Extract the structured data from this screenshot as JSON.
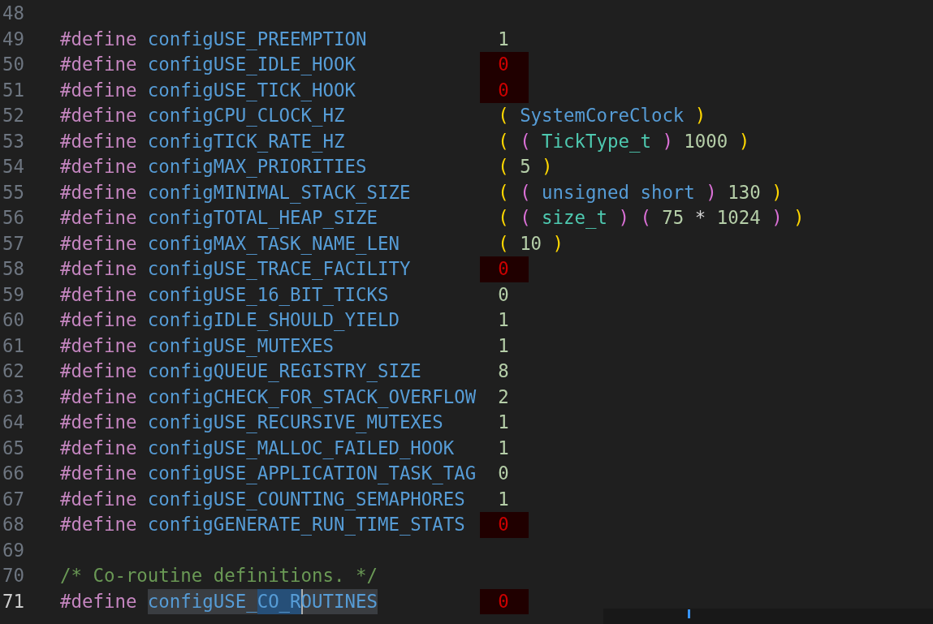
{
  "editor": {
    "lines": [
      {
        "number": "48",
        "kind": "blank",
        "current": false
      },
      {
        "number": "49",
        "kind": "define",
        "current": false,
        "directive": "#define",
        "name": "configUSE_PREEMPTION",
        "flagged": false,
        "value": [
          {
            "kind": "number",
            "text": "1"
          }
        ]
      },
      {
        "number": "50",
        "kind": "define",
        "current": false,
        "directive": "#define",
        "name": "configUSE_IDLE_HOOK",
        "flagged": true,
        "value": [
          {
            "kind": "number",
            "text": "0"
          }
        ]
      },
      {
        "number": "51",
        "kind": "define",
        "current": false,
        "directive": "#define",
        "name": "configUSE_TICK_HOOK",
        "flagged": true,
        "value": [
          {
            "kind": "number",
            "text": "0"
          }
        ]
      },
      {
        "number": "52",
        "kind": "define",
        "current": false,
        "directive": "#define",
        "name": "configCPU_CLOCK_HZ",
        "flagged": false,
        "value": [
          {
            "kind": "paren1",
            "text": "("
          },
          {
            "kind": "identifier",
            "text": "SystemCoreClock"
          },
          {
            "kind": "paren1",
            "text": ")"
          }
        ]
      },
      {
        "number": "53",
        "kind": "define",
        "current": false,
        "directive": "#define",
        "name": "configTICK_RATE_HZ",
        "flagged": false,
        "value": [
          {
            "kind": "paren1",
            "text": "("
          },
          {
            "kind": "paren2",
            "text": "("
          },
          {
            "kind": "type",
            "text": "TickType_t"
          },
          {
            "kind": "paren2",
            "text": ")"
          },
          {
            "kind": "number",
            "text": "1000"
          },
          {
            "kind": "paren1",
            "text": ")"
          }
        ]
      },
      {
        "number": "54",
        "kind": "define",
        "current": false,
        "directive": "#define",
        "name": "configMAX_PRIORITIES",
        "flagged": false,
        "value": [
          {
            "kind": "paren1",
            "text": "("
          },
          {
            "kind": "number",
            "text": "5"
          },
          {
            "kind": "paren1",
            "text": ")"
          }
        ]
      },
      {
        "number": "55",
        "kind": "define",
        "current": false,
        "directive": "#define",
        "name": "configMINIMAL_STACK_SIZE",
        "flagged": false,
        "value": [
          {
            "kind": "paren1",
            "text": "("
          },
          {
            "kind": "paren2",
            "text": "("
          },
          {
            "kind": "keyword",
            "text": "unsigned short"
          },
          {
            "kind": "paren2",
            "text": ")"
          },
          {
            "kind": "number",
            "text": "130"
          },
          {
            "kind": "paren1",
            "text": ")"
          }
        ]
      },
      {
        "number": "56",
        "kind": "define",
        "current": false,
        "directive": "#define",
        "name": "configTOTAL_HEAP_SIZE",
        "flagged": false,
        "value": [
          {
            "kind": "paren1",
            "text": "("
          },
          {
            "kind": "paren2",
            "text": "("
          },
          {
            "kind": "type",
            "text": "size_t"
          },
          {
            "kind": "paren2",
            "text": ")"
          },
          {
            "kind": "paren2",
            "text": "("
          },
          {
            "kind": "number",
            "text": "75"
          },
          {
            "kind": "operator",
            "text": "*"
          },
          {
            "kind": "number",
            "text": "1024"
          },
          {
            "kind": "paren2",
            "text": ")"
          },
          {
            "kind": "paren1",
            "text": ")"
          }
        ]
      },
      {
        "number": "57",
        "kind": "define",
        "current": false,
        "directive": "#define",
        "name": "configMAX_TASK_NAME_LEN",
        "flagged": false,
        "value": [
          {
            "kind": "paren1",
            "text": "("
          },
          {
            "kind": "number",
            "text": "10"
          },
          {
            "kind": "paren1",
            "text": ")"
          }
        ]
      },
      {
        "number": "58",
        "kind": "define",
        "current": false,
        "directive": "#define",
        "name": "configUSE_TRACE_FACILITY",
        "flagged": true,
        "value": [
          {
            "kind": "number",
            "text": "0"
          }
        ]
      },
      {
        "number": "59",
        "kind": "define",
        "current": false,
        "directive": "#define",
        "name": "configUSE_16_BIT_TICKS",
        "flagged": false,
        "value": [
          {
            "kind": "number",
            "text": "0"
          }
        ]
      },
      {
        "number": "60",
        "kind": "define",
        "current": false,
        "directive": "#define",
        "name": "configIDLE_SHOULD_YIELD",
        "flagged": false,
        "value": [
          {
            "kind": "number",
            "text": "1"
          }
        ]
      },
      {
        "number": "61",
        "kind": "define",
        "current": false,
        "directive": "#define",
        "name": "configUSE_MUTEXES",
        "flagged": false,
        "value": [
          {
            "kind": "number",
            "text": "1"
          }
        ]
      },
      {
        "number": "62",
        "kind": "define",
        "current": false,
        "directive": "#define",
        "name": "configQUEUE_REGISTRY_SIZE",
        "flagged": false,
        "value": [
          {
            "kind": "number",
            "text": "8"
          }
        ]
      },
      {
        "number": "63",
        "kind": "define",
        "current": false,
        "directive": "#define",
        "name": "configCHECK_FOR_STACK_OVERFLOW",
        "flagged": false,
        "value": [
          {
            "kind": "number",
            "text": "2"
          }
        ]
      },
      {
        "number": "64",
        "kind": "define",
        "current": false,
        "directive": "#define",
        "name": "configUSE_RECURSIVE_MUTEXES",
        "flagged": false,
        "value": [
          {
            "kind": "number",
            "text": "1"
          }
        ]
      },
      {
        "number": "65",
        "kind": "define",
        "current": false,
        "directive": "#define",
        "name": "configUSE_MALLOC_FAILED_HOOK",
        "flagged": false,
        "value": [
          {
            "kind": "number",
            "text": "1"
          }
        ]
      },
      {
        "number": "66",
        "kind": "define",
        "current": false,
        "directive": "#define",
        "name": "configUSE_APPLICATION_TASK_TAG",
        "flagged": false,
        "value": [
          {
            "kind": "number",
            "text": "0"
          }
        ]
      },
      {
        "number": "67",
        "kind": "define",
        "current": false,
        "directive": "#define",
        "name": "configUSE_COUNTING_SEMAPHORES",
        "flagged": false,
        "value": [
          {
            "kind": "number",
            "text": "1"
          }
        ]
      },
      {
        "number": "68",
        "kind": "define",
        "current": false,
        "directive": "#define",
        "name": "configGENERATE_RUN_TIME_STATS",
        "flagged": true,
        "value": [
          {
            "kind": "number",
            "text": "0"
          }
        ]
      },
      {
        "number": "69",
        "kind": "blank",
        "current": false
      },
      {
        "number": "70",
        "kind": "comment",
        "current": false,
        "text": "/* Co-routine definitions. */"
      },
      {
        "number": "71",
        "kind": "define",
        "current": true,
        "directive": "#define",
        "name_parts": [
          {
            "kind": "selected",
            "text": "configUSE_"
          },
          {
            "kind": "match",
            "text": "CO_R"
          },
          {
            "kind": "caret-selected",
            "text": "OUTINES"
          }
        ],
        "flagged": true,
        "value": [
          {
            "kind": "number",
            "text": "0"
          }
        ]
      }
    ]
  }
}
